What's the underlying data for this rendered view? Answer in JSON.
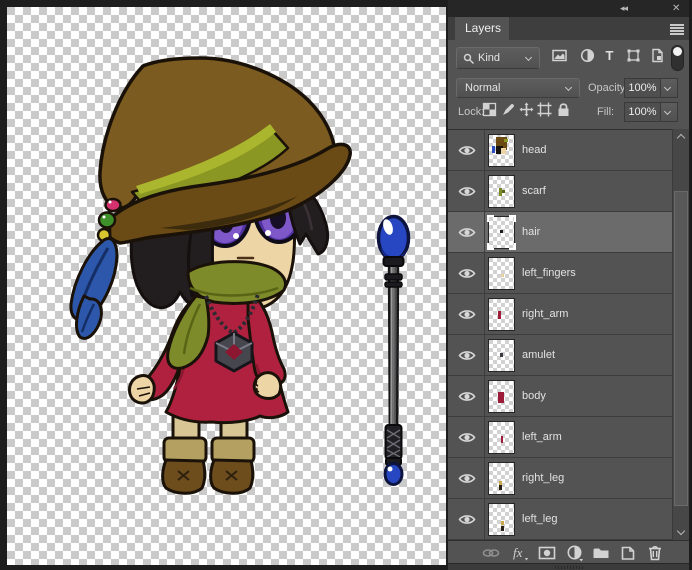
{
  "window": {
    "collapse_glyph": "◂◂",
    "close_glyph": "✕"
  },
  "panel": {
    "tab_label": "Layers",
    "search": {
      "kind_label": "Kind"
    },
    "filter_icons": [
      "pixel-layer-filter",
      "adjustment-layer-filter",
      "type-layer-filter",
      "shape-layer-filter",
      "smart-object-filter"
    ],
    "blend": {
      "mode": "Normal",
      "opacity_label": "Opacity:",
      "opacity_value": "100%"
    },
    "lock": {
      "label": "Lock:",
      "fill_label": "Fill:",
      "fill_value": "100%",
      "icons": [
        "lock-transparency",
        "lock-image-pixels",
        "lock-position",
        "lock-artboard",
        "lock-all"
      ]
    },
    "layers": {
      "selected": "hair",
      "items": [
        {
          "name": "head",
          "visible": true,
          "thumb": [
            [
              28,
              8,
              44,
              40,
              "#6b4a14"
            ],
            [
              26,
              34,
              30,
              28,
              "#17130f"
            ],
            [
              46,
              42,
              22,
              20,
              "#ecd3a2"
            ],
            [
              10,
              36,
              14,
              22,
              "#2b4fc0"
            ],
            [
              58,
              12,
              18,
              12,
              "#8a9824"
            ]
          ]
        },
        {
          "name": "scarf",
          "visible": true,
          "thumb": [
            [
              40,
              40,
              12,
              26,
              "#7d8b2a"
            ],
            [
              50,
              46,
              12,
              10,
              "#5a6518"
            ]
          ]
        },
        {
          "name": "hair",
          "visible": true,
          "thumb": [
            [
              42,
              42,
              15,
              10,
              "#1c1c1c"
            ]
          ]
        },
        {
          "name": "left_fingers",
          "visible": true,
          "thumb": [
            [
              46,
              50,
              12,
              10,
              "#e8d0a0"
            ]
          ]
        },
        {
          "name": "right_arm",
          "visible": true,
          "thumb": [
            [
              34,
              38,
              12,
              28,
              "#a01d3a"
            ]
          ]
        },
        {
          "name": "amulet",
          "visible": true,
          "thumb": [
            [
              44,
              42,
              10,
              12,
              "#3c3c44"
            ]
          ]
        },
        {
          "name": "body",
          "visible": true,
          "thumb": [
            [
              34,
              36,
              26,
              34,
              "#9c1b38"
            ]
          ]
        },
        {
          "name": "left_arm",
          "visible": true,
          "thumb": [
            [
              46,
              44,
              10,
              24,
              "#a01d3a"
            ]
          ]
        },
        {
          "name": "right_leg",
          "visible": true,
          "thumb": [
            [
              40,
              58,
              12,
              12,
              "#caa84e"
            ],
            [
              40,
              72,
              12,
              14,
              "#2a2015"
            ]
          ]
        },
        {
          "name": "left_leg",
          "visible": true,
          "thumb": [
            [
              46,
              56,
              12,
              12,
              "#caa84e"
            ],
            [
              46,
              70,
              12,
              16,
              "#2a2015"
            ]
          ]
        }
      ]
    },
    "footer_icons": [
      "link-layers",
      "layer-effects",
      "layer-mask",
      "adjustment-layer",
      "new-group",
      "new-layer",
      "delete-layer"
    ]
  },
  "canvas": {
    "transparency_checker_light": "#ffffff",
    "transparency_checker_dark": "#cacaca",
    "character_palette": {
      "hat_brown": "#7b5b1f",
      "hat_brim": "#6b4b15",
      "hat_band": "#8a9723",
      "hat_band_light": "#aab72e",
      "hair_black": "#221d1f",
      "skin": "#eed5a5",
      "eye_iris": "#7e57c9",
      "eye_ring": "#5033a0",
      "scarf_olive": "#7e8b2b",
      "dress_red": "#b02140",
      "legs_khaki": "#d8c795",
      "boot_cuff": "#b4a162",
      "boot_brown": "#6e4d1d",
      "feather_blue": "#2c57aa",
      "bead_pink": "#d4326e",
      "bead_green": "#3f8f2b",
      "bead_yellow": "#d9c52e",
      "amulet_gray": "#46464e",
      "amulet_core": "#8c1730"
    },
    "staff_palette": {
      "shaft_gray": "#6f6f6f",
      "orb_blue": "#2646c2"
    }
  }
}
